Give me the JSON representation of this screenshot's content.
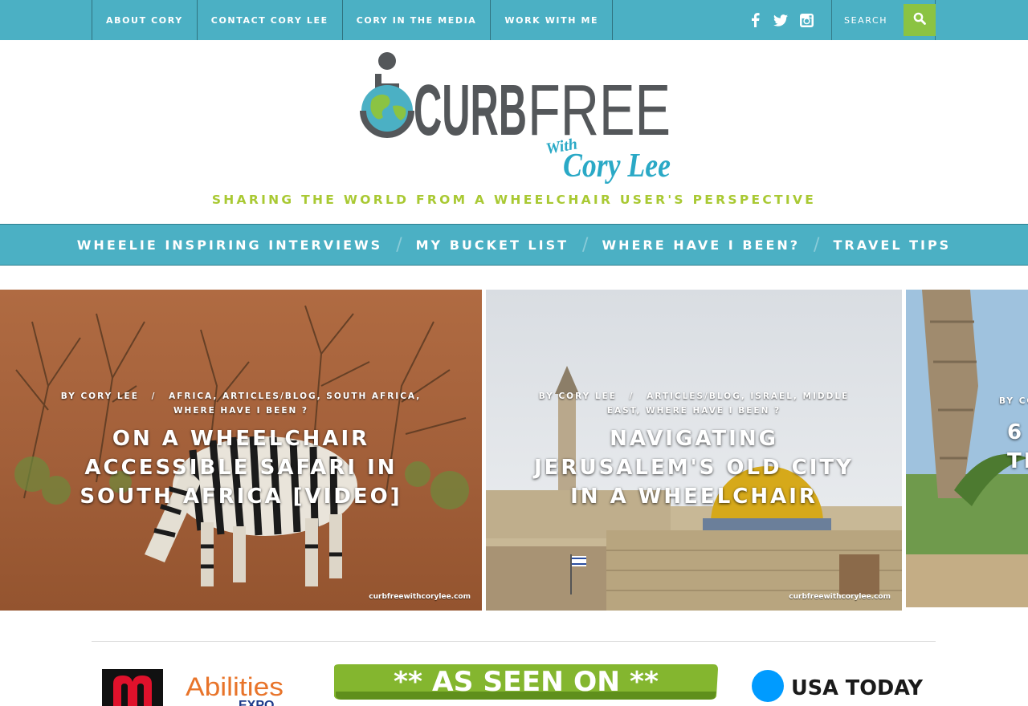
{
  "top_nav": {
    "items": [
      {
        "label": "ABOUT CORY"
      },
      {
        "label": "CONTACT CORY LEE"
      },
      {
        "label": "CORY IN THE MEDIA"
      },
      {
        "label": "WORK WITH ME"
      }
    ],
    "social_icons": [
      "facebook-icon",
      "twitter-icon",
      "instagram-icon"
    ],
    "search": {
      "placeholder": "SEARCH",
      "button_icon": "search-icon"
    }
  },
  "header": {
    "logo_text": {
      "curb": "CURB",
      "free": "FREE",
      "with": "With",
      "name": "Cory Lee"
    },
    "tagline": "SHARING THE WORLD FROM A WHEELCHAIR USER'S PERSPECTIVE"
  },
  "main_nav": {
    "items": [
      {
        "label": "WHEELIE INSPIRING INTERVIEWS"
      },
      {
        "label": "MY BUCKET LIST"
      },
      {
        "label": "WHERE HAVE I BEEN?"
      },
      {
        "label": "TRAVEL TIPS"
      }
    ],
    "separator": "/"
  },
  "slides": [
    {
      "author": "BY CORY LEE",
      "separator": "/",
      "categories": "AFRICA, ARTICLES/BLOG, SOUTH AFRICA, WHERE HAVE I BEEN ?",
      "title": "ON A WHEELCHAIR ACCESSIBLE SAFARI IN SOUTH AFRICA [VIDEO]",
      "watermark": "curbfreewithcorylee.com"
    },
    {
      "author": "BY CORY LEE",
      "separator": "/",
      "categories": "ARTICLES/BLOG, ISRAEL, MIDDLE EAST, WHERE HAVE I BEEN ?",
      "title": "NAVIGATING JERUSALEM'S OLD CITY IN A WHEELCHAIR",
      "watermark": "curbfreewithcorylee.com"
    },
    {
      "author": "BY CO",
      "title_line1": "6",
      "title_line2": "TI"
    }
  ],
  "featured": {
    "abilities_expo": {
      "line1": "Abilities",
      "line2": "EXPO"
    },
    "as_seen_on": "** AS SEEN ON **",
    "usa_today": "USA TODAY"
  },
  "colors": {
    "teal": "#4bb0c4",
    "green": "#8bc343",
    "tagline_green": "#a9c933",
    "logo_gray": "#54575a"
  }
}
